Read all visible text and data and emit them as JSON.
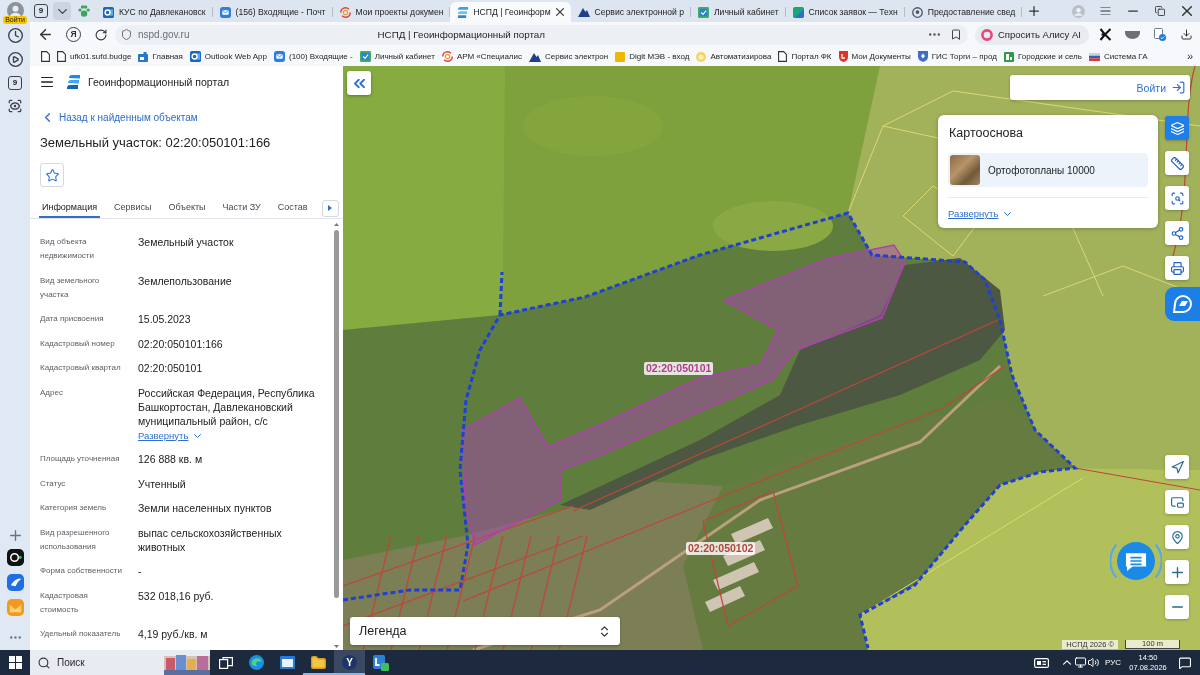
{
  "browser": {
    "sidebar": {
      "profile_badge": "Войти",
      "counter": "9"
    },
    "tab_strip": {
      "tab_count": "9",
      "tabs": [
        {
          "kind": "outlook",
          "title": "КУС по Давлекановск",
          "selected": false
        },
        {
          "kind": "mail",
          "title": "(156) Входящие - Почт",
          "selected": false
        },
        {
          "kind": "swirl",
          "title": "Мои проекты докумен",
          "selected": false
        },
        {
          "kind": "logo",
          "title": "НСПД | Геоинформ",
          "selected": true
        },
        {
          "kind": "mountain",
          "title": "Сервис электронной р",
          "selected": false
        },
        {
          "kind": "cabinet",
          "title": "Личный кабинет",
          "selected": false
        },
        {
          "kind": "split",
          "title": "Список заявок — Техн",
          "selected": false
        },
        {
          "kind": "pin",
          "title": "Предоставление свед",
          "selected": false
        }
      ]
    },
    "toolbar": {
      "home_button": "Я",
      "url": "nspd.gov.ru",
      "page_title": "НСПД | Геоинформационный портал",
      "assistant_button": "Спросить Алису AI"
    },
    "bookmarks": {
      "items": [
        {
          "kind": "page",
          "title": "ufk01.sufd.budge"
        },
        {
          "kind": "tag",
          "title": "Главная"
        },
        {
          "kind": "outlook",
          "title": "Outlook Web App"
        },
        {
          "kind": "mail",
          "title": "(100) Входящие -"
        },
        {
          "kind": "cabinet",
          "title": "Личный кабинет"
        },
        {
          "kind": "swirl",
          "title": "АРМ «Специалис"
        },
        {
          "kind": "mountain",
          "title": "Сервис электрон"
        },
        {
          "kind": "square",
          "title": "Digit МЭВ - вход"
        },
        {
          "kind": "coin",
          "title": "Автоматизирова"
        },
        {
          "kind": "page",
          "title": "Портал ФК"
        },
        {
          "kind": "shield",
          "title": "Мои Документы"
        },
        {
          "kind": "emblem",
          "title": "ГИС Торги – прод"
        },
        {
          "kind": "grid",
          "title": "Городские и сель"
        },
        {
          "kind": "flag",
          "title": "Система ГА"
        }
      ],
      "overflow": "»"
    }
  },
  "portal": {
    "title": "Геоинформационный портал",
    "back_link": "Назад к найденным объектам",
    "heading": "Земельный участок: 02:20:050101:166",
    "favorite": false,
    "tabs": [
      {
        "label": "Информация",
        "selected": true
      },
      {
        "label": "Сервисы",
        "selected": false
      },
      {
        "label": "Объекты",
        "selected": false
      },
      {
        "label": "Части ЗУ",
        "selected": false
      },
      {
        "label": "Состав",
        "selected": false
      }
    ],
    "properties": [
      {
        "label": "Вид объекта недвижимости",
        "value": "Земельный участок"
      },
      {
        "label": "Вид земельного участка",
        "value": "Землепользование"
      },
      {
        "label": "Дата присвоения",
        "value": "15.05.2023"
      },
      {
        "label": "Кадастровый номер",
        "value": "02:20:050101:166"
      },
      {
        "label": "Кадастровый квартал",
        "value": "02:20:050101"
      },
      {
        "label": "Адрес",
        "value": "Российская Федерация, Республика Башкортостан, Давлекановский муниципальный район, с/с",
        "expand_link": "Развернуть"
      },
      {
        "label": "Площадь уточненная",
        "value": "126 888 кв. м"
      },
      {
        "label": "Статус",
        "value": "Учтенный"
      },
      {
        "label": "Категория земель",
        "value": "Земли населенных пунктов"
      },
      {
        "label": "Вид разрешенного использования",
        "value": "выпас сельскохозяйственных животных"
      },
      {
        "label": "Форма собственности",
        "value": "-"
      },
      {
        "label": "Кадастровая стоимость",
        "value": "532 018,16 руб."
      },
      {
        "label": "Удельный показатель",
        "value": "4,19 руб./кв. м"
      }
    ]
  },
  "map": {
    "login_button": "Войти",
    "basemap": {
      "title": "Картооснова",
      "layer": "Ортофотопланы 10000",
      "expand_link": "Развернуть"
    },
    "tools": [
      {
        "kind": "layers",
        "selected": true
      },
      {
        "kind": "ruler",
        "selected": false
      },
      {
        "kind": "select-area",
        "selected": false
      },
      {
        "kind": "share",
        "selected": false
      },
      {
        "kind": "print",
        "selected": false
      }
    ],
    "labels": [
      {
        "text": "02:20:050101",
        "color": "#b53a8f"
      },
      {
        "text": "02:20:050102",
        "color": "#b4443c"
      }
    ],
    "legend": "Легенда",
    "attribution": "НСПД 2026 ©",
    "scale": "100 m"
  },
  "taskbar": {
    "search_placeholder": "Поиск",
    "apps": [
      {
        "kind": "task-view",
        "selected": false,
        "running": false
      },
      {
        "kind": "browser",
        "selected": false,
        "running": false
      },
      {
        "kind": "window",
        "selected": false,
        "running": false
      },
      {
        "kind": "folder",
        "selected": false,
        "running": true
      },
      {
        "kind": "letter",
        "label": "Y",
        "selected": true,
        "running": true
      },
      {
        "kind": "tile",
        "selected": false,
        "running": false
      }
    ],
    "language": "РУС",
    "time": "14:50",
    "date": "07.08.2026"
  }
}
